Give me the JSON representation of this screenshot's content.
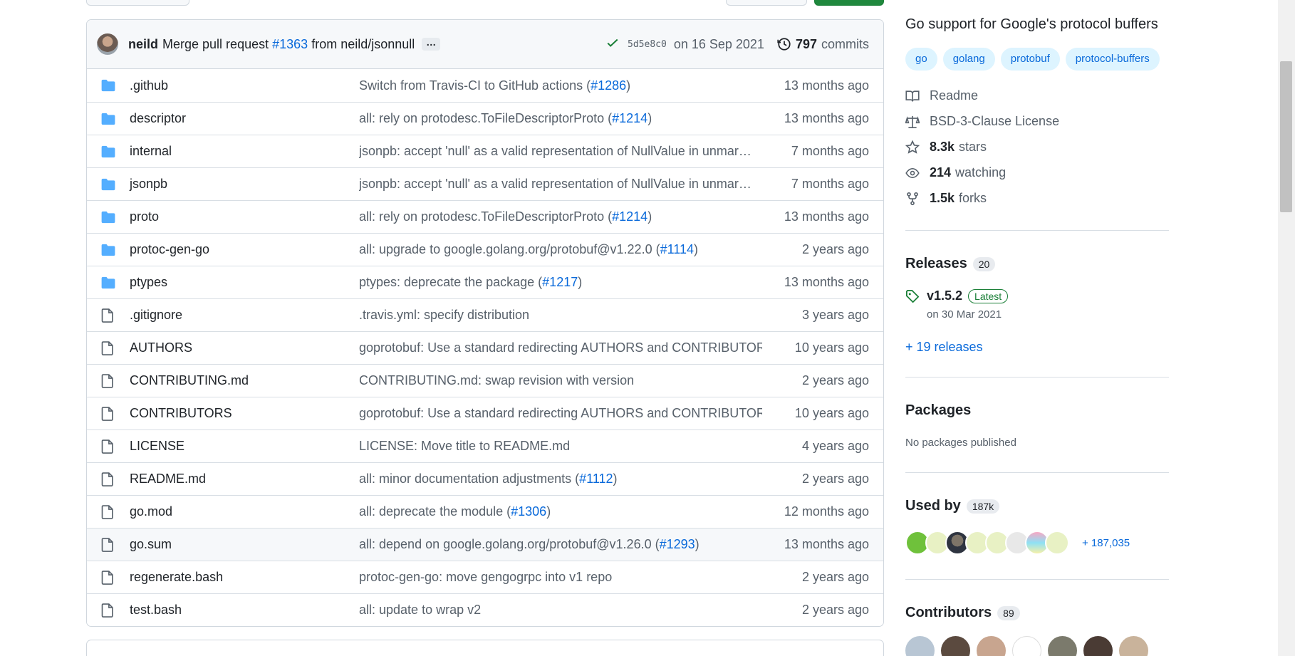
{
  "latest_commit": {
    "author": "neild",
    "message_prefix": "Merge pull request",
    "pr": "#1363",
    "message_suffix": "from neild/jsonnull",
    "ellipsis": "…",
    "sha": "5d5e8c0",
    "date": "on 16 Sep 2021",
    "commit_count": "797",
    "commits_label": "commits"
  },
  "files": [
    {
      "type": "dir",
      "name": ".github",
      "msg": "Switch from Travis-CI to GitHub actions (",
      "pr": "#1286",
      "msg_end": ")",
      "age": "13 months ago"
    },
    {
      "type": "dir",
      "name": "descriptor",
      "msg": "all: rely on protodesc.ToFileDescriptorProto (",
      "pr": "#1214",
      "msg_end": ")",
      "age": "13 months ago"
    },
    {
      "type": "dir",
      "name": "internal",
      "msg": "jsonpb: accept 'null' as a valid representation of NullValue in unmar…",
      "pr": "",
      "msg_end": "",
      "age": "7 months ago"
    },
    {
      "type": "dir",
      "name": "jsonpb",
      "msg": "jsonpb: accept 'null' as a valid representation of NullValue in unmar…",
      "pr": "",
      "msg_end": "",
      "age": "7 months ago"
    },
    {
      "type": "dir",
      "name": "proto",
      "msg": "all: rely on protodesc.ToFileDescriptorProto (",
      "pr": "#1214",
      "msg_end": ")",
      "age": "13 months ago"
    },
    {
      "type": "dir",
      "name": "protoc-gen-go",
      "msg": "all: upgrade to google.golang.org/protobuf@v1.22.0 (",
      "pr": "#1114",
      "msg_end": ")",
      "age": "2 years ago"
    },
    {
      "type": "dir",
      "name": "ptypes",
      "msg": "ptypes: deprecate the package (",
      "pr": "#1217",
      "msg_end": ")",
      "age": "13 months ago"
    },
    {
      "type": "file",
      "name": ".gitignore",
      "msg": ".travis.yml: specify distribution",
      "pr": "",
      "msg_end": "",
      "age": "3 years ago"
    },
    {
      "type": "file",
      "name": "AUTHORS",
      "msg": "goprotobuf: Use a standard redirecting AUTHORS and CONTRIBUTORS f…",
      "pr": "",
      "msg_end": "",
      "age": "10 years ago"
    },
    {
      "type": "file",
      "name": "CONTRIBUTING.md",
      "msg": "CONTRIBUTING.md: swap revision with version",
      "pr": "",
      "msg_end": "",
      "age": "2 years ago"
    },
    {
      "type": "file",
      "name": "CONTRIBUTORS",
      "msg": "goprotobuf: Use a standard redirecting AUTHORS and CONTRIBUTORS f…",
      "pr": "",
      "msg_end": "",
      "age": "10 years ago"
    },
    {
      "type": "file",
      "name": "LICENSE",
      "msg": "LICENSE: Move title to README.md",
      "pr": "",
      "msg_end": "",
      "age": "4 years ago"
    },
    {
      "type": "file",
      "name": "README.md",
      "msg": "all: minor documentation adjustments (",
      "pr": "#1112",
      "msg_end": ")",
      "age": "2 years ago"
    },
    {
      "type": "file",
      "name": "go.mod",
      "msg": "all: deprecate the module (",
      "pr": "#1306",
      "msg_end": ")",
      "age": "12 months ago"
    },
    {
      "type": "file",
      "name": "go.sum",
      "msg": "all: depend on google.golang.org/protobuf@v1.26.0 (",
      "pr": "#1293",
      "msg_end": ")",
      "age": "13 months ago"
    },
    {
      "type": "file",
      "name": "regenerate.bash",
      "msg": "protoc-gen-go: move gengogrpc into v1 repo",
      "pr": "",
      "msg_end": "",
      "age": "2 years ago"
    },
    {
      "type": "file",
      "name": "test.bash",
      "msg": "all: update to wrap v2",
      "pr": "",
      "msg_end": "",
      "age": "2 years ago"
    }
  ],
  "about": {
    "description": "Go support for Google's protocol buffers",
    "topics": [
      "go",
      "golang",
      "protobuf",
      "protocol-buffers"
    ],
    "readme": "Readme",
    "license": "BSD-3-Clause License",
    "stars_count": "8.3k",
    "stars_label": "stars",
    "watching_count": "214",
    "watching_label": "watching",
    "forks_count": "1.5k",
    "forks_label": "forks"
  },
  "releases": {
    "title": "Releases",
    "count": "20",
    "version": "v1.5.2",
    "latest_label": "Latest",
    "date": "on 30 Mar 2021",
    "more": "+ 19 releases"
  },
  "packages": {
    "title": "Packages",
    "empty": "No packages published"
  },
  "used_by": {
    "title": "Used by",
    "count": "187k",
    "more": "+ 187,035"
  },
  "contributors": {
    "title": "Contributors",
    "count": "89"
  },
  "colors": {
    "link": "#0969da",
    "folder": "#54aeff",
    "success": "#1a7f37",
    "muted": "#57606a"
  }
}
